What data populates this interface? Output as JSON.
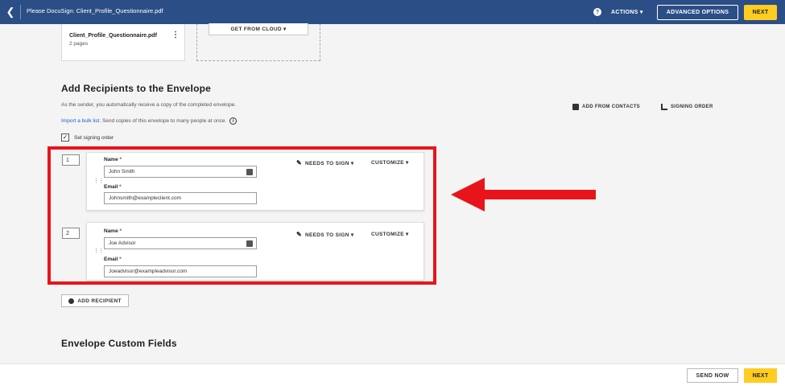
{
  "topbar": {
    "back_icon": "chevron-left-icon",
    "title": "Please DocuSign: Client_Profile_Questionnaire.pdf",
    "help_icon": "help-circle-icon",
    "actions_label": "ACTIONS ▾",
    "advanced_options_label": "ADVANCED OPTIONS",
    "next_label": "NEXT",
    "bar_color": "#2c4e86",
    "accent_color": "#ffcc22"
  },
  "document": {
    "name": "Client_Profile_Questionnaire.pdf",
    "pages": "2 pages",
    "get_from_cloud_label": "GET FROM CLOUD ▾"
  },
  "recipients": {
    "title": "Add Recipients to the Envelope",
    "sender_note": "As the sender, you automatically receive a copy of the completed envelope.",
    "bulk_link": "Import a bulk list",
    "bulk_text": ". Send copies of this envelope to many people at once.",
    "add_from_contacts_label": "ADD FROM CONTACTS",
    "signing_order_label": "SIGNING ORDER",
    "set_signing_order_label": "Set signing order",
    "set_signing_order_checked": true,
    "items": [
      {
        "order": "1",
        "name_label": "Name",
        "name_value": "John Smith",
        "email_label": "Email",
        "email_value": "Johnsmith@exampleclient.com",
        "role_label": "NEEDS TO SIGN ▾",
        "customize_label": "CUSTOMIZE ▾"
      },
      {
        "order": "2",
        "name_label": "Name",
        "name_value": "Joe Advisor",
        "email_label": "Email",
        "email_value": "Joeadvisor@exampleadvisor.com",
        "role_label": "NEEDS TO SIGN ▾",
        "customize_label": "CUSTOMIZE ▾"
      }
    ],
    "add_recipient_label": "ADD RECIPIENT",
    "required_marker": "*",
    "highlight_color": "#e8141c"
  },
  "custom_fields": {
    "title": "Envelope Custom Fields"
  },
  "footer": {
    "send_now_label": "SEND NOW",
    "next_label": "NEXT"
  }
}
